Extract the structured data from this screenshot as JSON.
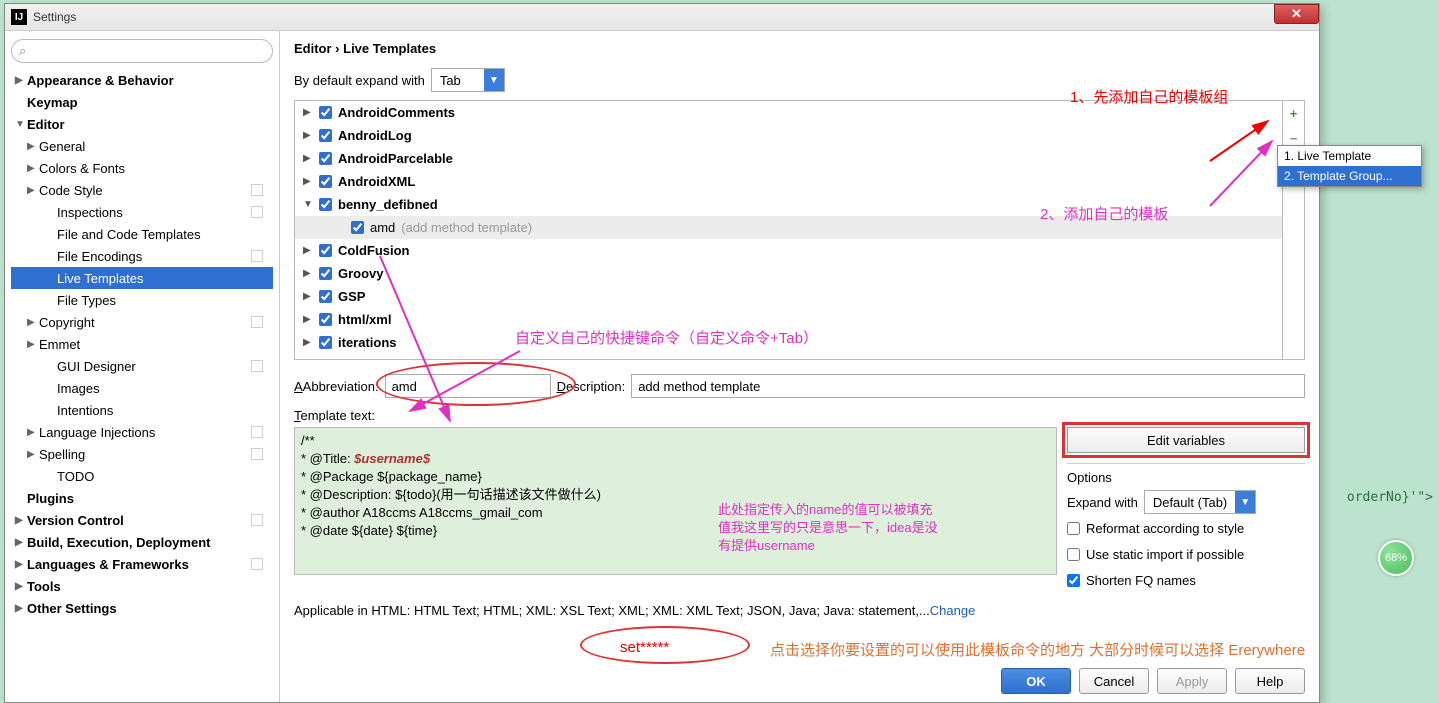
{
  "window": {
    "title": "Settings"
  },
  "breadcrumb": {
    "a": "Editor",
    "b": "Live Templates"
  },
  "expand": {
    "label": "By default expand with",
    "value": "Tab"
  },
  "sidebar": {
    "items": [
      {
        "label": "Appearance & Behavior",
        "bold": true,
        "caret": "closed",
        "lvl": 0
      },
      {
        "label": "Keymap",
        "bold": true,
        "caret": "none",
        "lvl": 0
      },
      {
        "label": "Editor",
        "bold": true,
        "caret": "open",
        "lvl": 0
      },
      {
        "label": "General",
        "caret": "closed",
        "lvl": 1
      },
      {
        "label": "Colors & Fonts",
        "caret": "closed",
        "lvl": 1
      },
      {
        "label": "Code Style",
        "caret": "closed",
        "lvl": 1,
        "badge": true
      },
      {
        "label": "Inspections",
        "caret": "none",
        "lvl": 2,
        "badge": true
      },
      {
        "label": "File and Code Templates",
        "caret": "none",
        "lvl": 2
      },
      {
        "label": "File Encodings",
        "caret": "none",
        "lvl": 2,
        "badge": true
      },
      {
        "label": "Live Templates",
        "caret": "none",
        "lvl": 2,
        "sel": true
      },
      {
        "label": "File Types",
        "caret": "none",
        "lvl": 2
      },
      {
        "label": "Copyright",
        "caret": "closed",
        "lvl": 1,
        "badge": true
      },
      {
        "label": "Emmet",
        "caret": "closed",
        "lvl": 1
      },
      {
        "label": "GUI Designer",
        "caret": "none",
        "lvl": 2,
        "badge": true
      },
      {
        "label": "Images",
        "caret": "none",
        "lvl": 2
      },
      {
        "label": "Intentions",
        "caret": "none",
        "lvl": 2
      },
      {
        "label": "Language Injections",
        "caret": "closed",
        "lvl": 1,
        "badge": true
      },
      {
        "label": "Spelling",
        "caret": "closed",
        "lvl": 1,
        "badge": true
      },
      {
        "label": "TODO",
        "caret": "none",
        "lvl": 2
      },
      {
        "label": "Plugins",
        "bold": true,
        "caret": "none",
        "lvl": 0
      },
      {
        "label": "Version Control",
        "bold": true,
        "caret": "closed",
        "lvl": 0,
        "badge": true
      },
      {
        "label": "Build, Execution, Deployment",
        "bold": true,
        "caret": "closed",
        "lvl": 0
      },
      {
        "label": "Languages & Frameworks",
        "bold": true,
        "caret": "closed",
        "lvl": 0,
        "badge": true
      },
      {
        "label": "Tools",
        "bold": true,
        "caret": "closed",
        "lvl": 0
      },
      {
        "label": "Other Settings",
        "bold": true,
        "caret": "closed",
        "lvl": 0
      }
    ]
  },
  "groups": [
    {
      "label": "AndroidComments",
      "caret": "▶"
    },
    {
      "label": "AndroidLog",
      "caret": "▶"
    },
    {
      "label": "AndroidParcelable",
      "caret": "▶"
    },
    {
      "label": "AndroidXML",
      "caret": "▶"
    },
    {
      "label": "benny_defibned",
      "caret": "▼",
      "open": true
    },
    {
      "label": "amd",
      "hint": "(add method template)",
      "child": true,
      "sel": true
    },
    {
      "label": "ColdFusion",
      "caret": "▶"
    },
    {
      "label": "Groovy",
      "caret": "▶"
    },
    {
      "label": "GSP",
      "caret": "▶"
    },
    {
      "label": "html/xml",
      "caret": "▶"
    },
    {
      "label": "iterations",
      "caret": "▶"
    }
  ],
  "form": {
    "abbrev_label": "Abbreviation:",
    "abbrev_value": "amd",
    "desc_label": "Description:",
    "desc_value": "add method template",
    "tmpl_label": "Template text:",
    "code_l1": "/**",
    "code_l2_a": "* @Title: ",
    "code_l2_b": "$username$",
    "code_l3": "* @Package ${package_name}",
    "code_l4": "* @Description: ${todo}(用一句话描述该文件做什么)",
    "code_l5": "* @author A18ccms A18ccms_gmail_com",
    "code_l6": "* @date ${date} ${time}",
    "editvars": "Edit variables",
    "options_hdr": "Options",
    "expandwith_label": "Expand with",
    "expandwith_value": "Default (Tab)",
    "opt1": "Reformat according to style",
    "opt2": "Use static import if possible",
    "opt3": "Shorten FQ names",
    "applic_a": "Applicable in HTML: HTML Text; HTML; XML: XSL Text; XML; XML: XML Text; JSON, Java; Java: statement,...",
    "applic_b": "Change"
  },
  "popup": {
    "i1": "1. Live Template",
    "i2": "2. Template Group..."
  },
  "buttons": {
    "ok": "OK",
    "cancel": "Cancel",
    "apply": "Apply",
    "help": "Help"
  },
  "anno": {
    "a1": "1、先添加自己的模板组",
    "a2": "2、添加自己的模板",
    "a3": "自定义自己的快捷键命令（自定义命令+Tab）",
    "a4a": "此处指定传入的name的值可以被填充",
    "a4b": "值我这里写的只是意思一下，idea是没",
    "a4c": "有提供username",
    "a5": "set*****",
    "a6": "点击选择你要设置的可以使用此模板命令的地方  大部分时候可以选择 Ererywhere"
  },
  "bg": {
    "badge": "68%",
    "snippet": "orderNo}'\">"
  }
}
